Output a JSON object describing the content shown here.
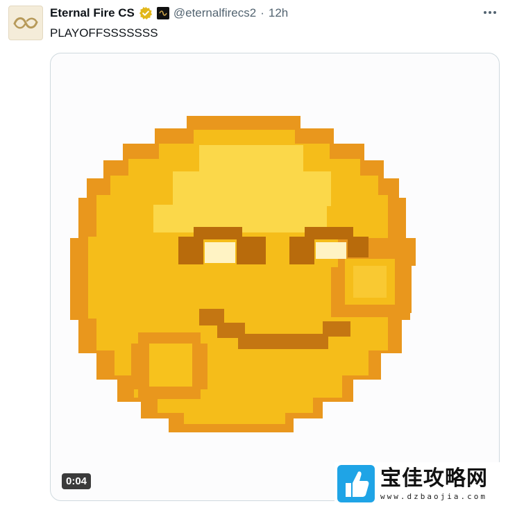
{
  "account": {
    "name": "Eternal Fire CS",
    "handle": "@eternalfirecs2",
    "separator": "·",
    "time": "12h"
  },
  "tweet": {
    "text": "PLAYOFFSSSSSSS"
  },
  "media": {
    "type": "video",
    "duration": "0:04"
  },
  "icons": {
    "verified": "verified-gold-badge-icon",
    "affiliate": "affiliate-badge-icon",
    "more": "more-options-icon"
  },
  "watermark": {
    "title": "宝佳攻略网",
    "url": "www.dzbaojia.com"
  },
  "colors": {
    "verified": "#e2b719",
    "text": "#0f1419",
    "secondary": "#536471",
    "border": "#cfd9de",
    "emoji_face": "#f7c51c",
    "emoji_outline": "#e9971d"
  }
}
